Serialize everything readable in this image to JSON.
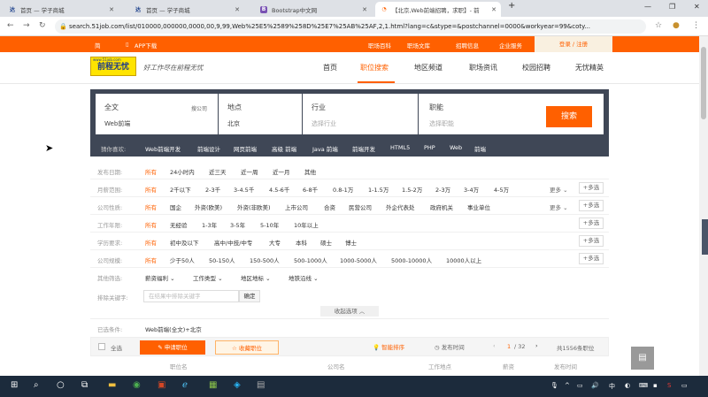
{
  "browser": {
    "tabs": [
      {
        "icon": "达",
        "title": "首页 — 学子商城",
        "icon_color": "#1a3e8a"
      },
      {
        "icon": "达",
        "title": "首页 — 学子商城",
        "icon_color": "#1a3e8a"
      },
      {
        "icon": "B",
        "title": "Bootstrap中文网",
        "icon_color": "#7952b3"
      },
      {
        "icon": "◔",
        "title": "【北京,Web前端招聘，求职】- 前",
        "icon_color": "#ff6000"
      }
    ],
    "new_tab": "+",
    "url": "search.51job.com/list/010000,000000,0000,00,9,99,Web%25E5%2589%258D%25E7%25AB%25AF,2,1.html?lang=c&stype=&postchannel=0000&workyear=99&coty..."
  },
  "topbar": {
    "left": "简",
    "app": "APP下载",
    "links": [
      "职场百科",
      "职场文库",
      "招聘信息",
      "企业服务"
    ],
    "login": "登录 / 注册"
  },
  "header": {
    "logo": "前程无忧",
    "logo_small": "www.51job.com",
    "slogan": "好工作尽在前程无忧",
    "nav": [
      "首页",
      "职位搜索",
      "地区频道",
      "职场资讯",
      "校园招聘",
      "无忧精英"
    ],
    "active_nav": 1
  },
  "search": {
    "keyword": {
      "label": "全文",
      "value": "Web前端",
      "sub": "搜公司"
    },
    "location": {
      "label": "地点",
      "value": "北京"
    },
    "industry": {
      "label": "行业",
      "placeholder": "选择行业"
    },
    "function": {
      "label": "职能",
      "placeholder": "选择职能"
    },
    "button": "搜索"
  },
  "guess": {
    "label": "猜你喜欢:",
    "items": [
      "Web前端开发",
      "前端设计",
      "网页前端",
      "高级 前端",
      "Java 前端",
      "前端开发",
      "HTML5",
      "PHP",
      "Web",
      "前端"
    ]
  },
  "filters": [
    {
      "label": "发布日期:",
      "options": [
        "所有",
        "24小时内",
        "近三天",
        "近一周",
        "近一月",
        "其他"
      ],
      "more": "",
      "multi": ""
    },
    {
      "label": "月薪范围:",
      "options": [
        "所有",
        "2千以下",
        "2-3千",
        "3-4.5千",
        "4.5-6千",
        "6-8千",
        "0.8-1万",
        "1-1.5万",
        "1.5-2万",
        "2-3万",
        "3-4万",
        "4-5万"
      ],
      "more": "更多",
      "multi": "+多选"
    },
    {
      "label": "公司性质:",
      "options": [
        "所有",
        "国企",
        "外资(欧美)",
        "外资(非欧美)",
        "上市公司",
        "合资",
        "民营公司",
        "外企代表处",
        "政府机关",
        "事业单位"
      ],
      "more": "更多",
      "multi": "+多选"
    },
    {
      "label": "工作年限:",
      "options": [
        "所有",
        "无经验",
        "1-3年",
        "3-5年",
        "5-10年",
        "10年以上"
      ],
      "more": "",
      "multi": "+多选"
    },
    {
      "label": "学历要求:",
      "options": [
        "所有",
        "初中及以下",
        "高中/中技/中专",
        "大专",
        "本科",
        "硕士",
        "博士"
      ],
      "more": "",
      "multi": "+多选"
    },
    {
      "label": "公司规模:",
      "options": [
        "所有",
        "少于50人",
        "50-150人",
        "150-500人",
        "500-1000人",
        "1000-5000人",
        "5000-10000人",
        "10000人以上"
      ],
      "more": "",
      "multi": "+多选"
    },
    {
      "label": "其他筛选:",
      "options": [
        "薪资福利",
        "工作类型",
        "地区地标",
        "地铁沿线"
      ],
      "more": "",
      "multi": ""
    }
  ],
  "keyword_filter": {
    "label": "排除关键字:",
    "placeholder": "在结果中排除关键字",
    "button": "确定"
  },
  "collapse": "收起选项",
  "conditions": {
    "label": "已选条件:",
    "value": "Web前端(全文)+北京"
  },
  "listbar": {
    "select_all": "全选",
    "apply": "申请职位",
    "favorite": "收藏职位",
    "smart_sort": "智能排序",
    "publish_time": "发布时间",
    "page": "1",
    "pages": "/ 32",
    "total": "共1556条职位"
  },
  "columns": [
    "职位名",
    "公司名",
    "工作地点",
    "薪资",
    "发布时间"
  ],
  "colors": {
    "brand": "#ff6000",
    "search_bg": "#3f4756"
  }
}
